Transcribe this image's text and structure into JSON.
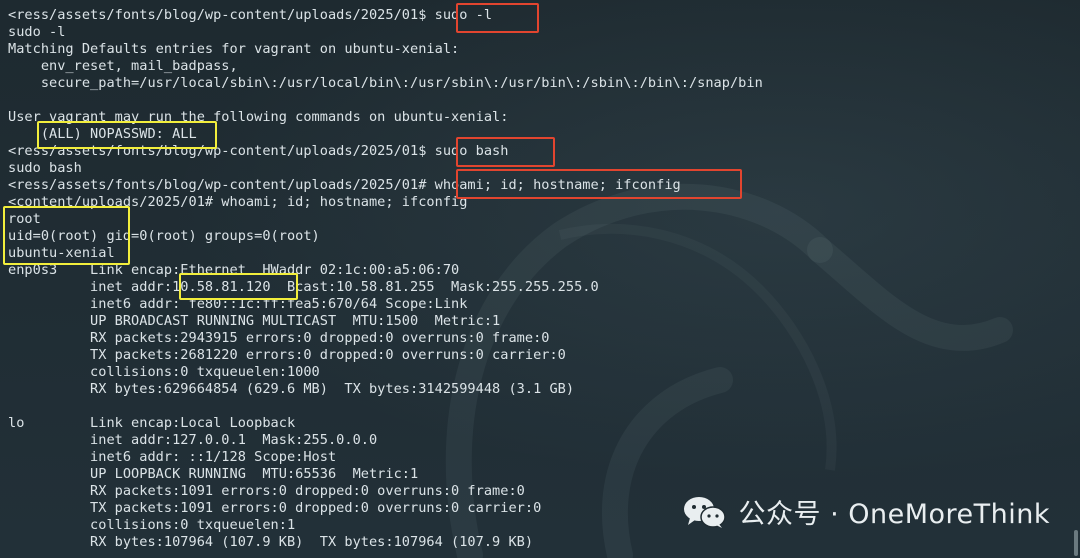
{
  "terminal": {
    "lines": [
      "<ress/assets/fonts/blog/wp-content/uploads/2025/01$ sudo -l",
      "sudo -l",
      "Matching Defaults entries for vagrant on ubuntu-xenial:",
      "    env_reset, mail_badpass,",
      "    secure_path=/usr/local/sbin\\:/usr/local/bin\\:/usr/sbin\\:/usr/bin\\:/sbin\\:/bin\\:/snap/bin",
      "",
      "User vagrant may run the following commands on ubuntu-xenial:",
      "    (ALL) NOPASSWD: ALL",
      "<ress/assets/fonts/blog/wp-content/uploads/2025/01$ sudo bash",
      "sudo bash",
      "<ress/assets/fonts/blog/wp-content/uploads/2025/01# whoami; id; hostname; ifconfig",
      "<content/uploads/2025/01# whoami; id; hostname; ifconfig",
      "root",
      "uid=0(root) gid=0(root) groups=0(root)",
      "ubuntu-xenial",
      "enp0s3    Link encap:Ethernet  HWaddr 02:1c:00:a5:06:70",
      "          inet addr:10.58.81.120  Bcast:10.58.81.255  Mask:255.255.255.0",
      "          inet6 addr: fe80::1c:ff:fea5:670/64 Scope:Link",
      "          UP BROADCAST RUNNING MULTICAST  MTU:1500  Metric:1",
      "          RX packets:2943915 errors:0 dropped:0 overruns:0 frame:0",
      "          TX packets:2681220 errors:0 dropped:0 overruns:0 carrier:0",
      "          collisions:0 txqueuelen:1000",
      "          RX bytes:629664854 (629.6 MB)  TX bytes:3142599448 (3.1 GB)",
      "",
      "lo        Link encap:Local Loopback",
      "          inet addr:127.0.0.1  Mask:255.0.0.0",
      "          inet6 addr: ::1/128 Scope:Host",
      "          UP LOOPBACK RUNNING  MTU:65536  Metric:1",
      "          RX packets:1091 errors:0 dropped:0 overruns:0 frame:0",
      "          TX packets:1091 errors:0 dropped:0 overruns:0 carrier:0",
      "          collisions:0 txqueuelen:1",
      "          RX bytes:107964 (107.9 KB)  TX bytes:107964 (107.9 KB)"
    ]
  },
  "watermark": {
    "text": "公众号 · OneMoreThink",
    "icon": "wechat-icon"
  },
  "colors": {
    "background": "#1f2b31",
    "text": "#dbe3e7",
    "highlight_red": "#e2452f",
    "highlight_yellow": "#f2ee3c"
  }
}
